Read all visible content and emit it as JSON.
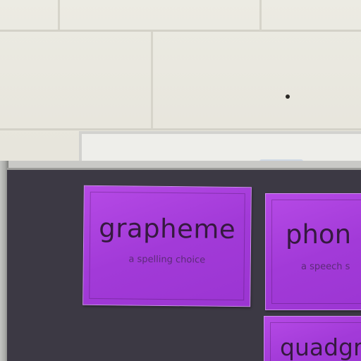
{
  "scene": {
    "description_kind": "classroom display board photo",
    "colors": {
      "wall": "#e7e5dc",
      "board": "#3c3944",
      "card": "#a23ad8",
      "card_text": "#35193f"
    }
  },
  "cards": [
    {
      "word": "grapheme",
      "subtitle": "a spelling choice"
    },
    {
      "word": "phon",
      "subtitle": "a speech s"
    },
    {
      "word": "quadgr",
      "subtitle": ""
    }
  ]
}
